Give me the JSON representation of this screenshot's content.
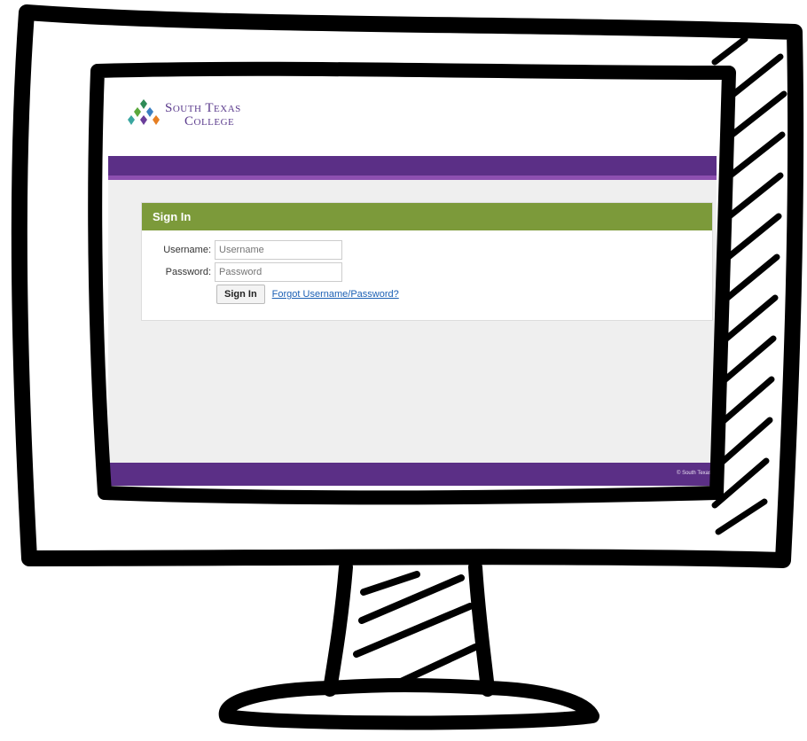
{
  "logo": {
    "line1": "South Texas",
    "line2": "College"
  },
  "signin": {
    "heading": "Sign In",
    "username_label": "Username:",
    "username_placeholder": "Username",
    "password_label": "Password:",
    "password_placeholder": "Password",
    "button_label": "Sign In",
    "forgot_link": "Forgot Username/Password?"
  },
  "footer": {
    "copyright": "© South Texas"
  },
  "colors": {
    "brand_purple": "#5b2f86",
    "accent_purple": "#8d4fb0",
    "signin_green": "#7c9a3a",
    "link_blue": "#1a5fb4"
  }
}
